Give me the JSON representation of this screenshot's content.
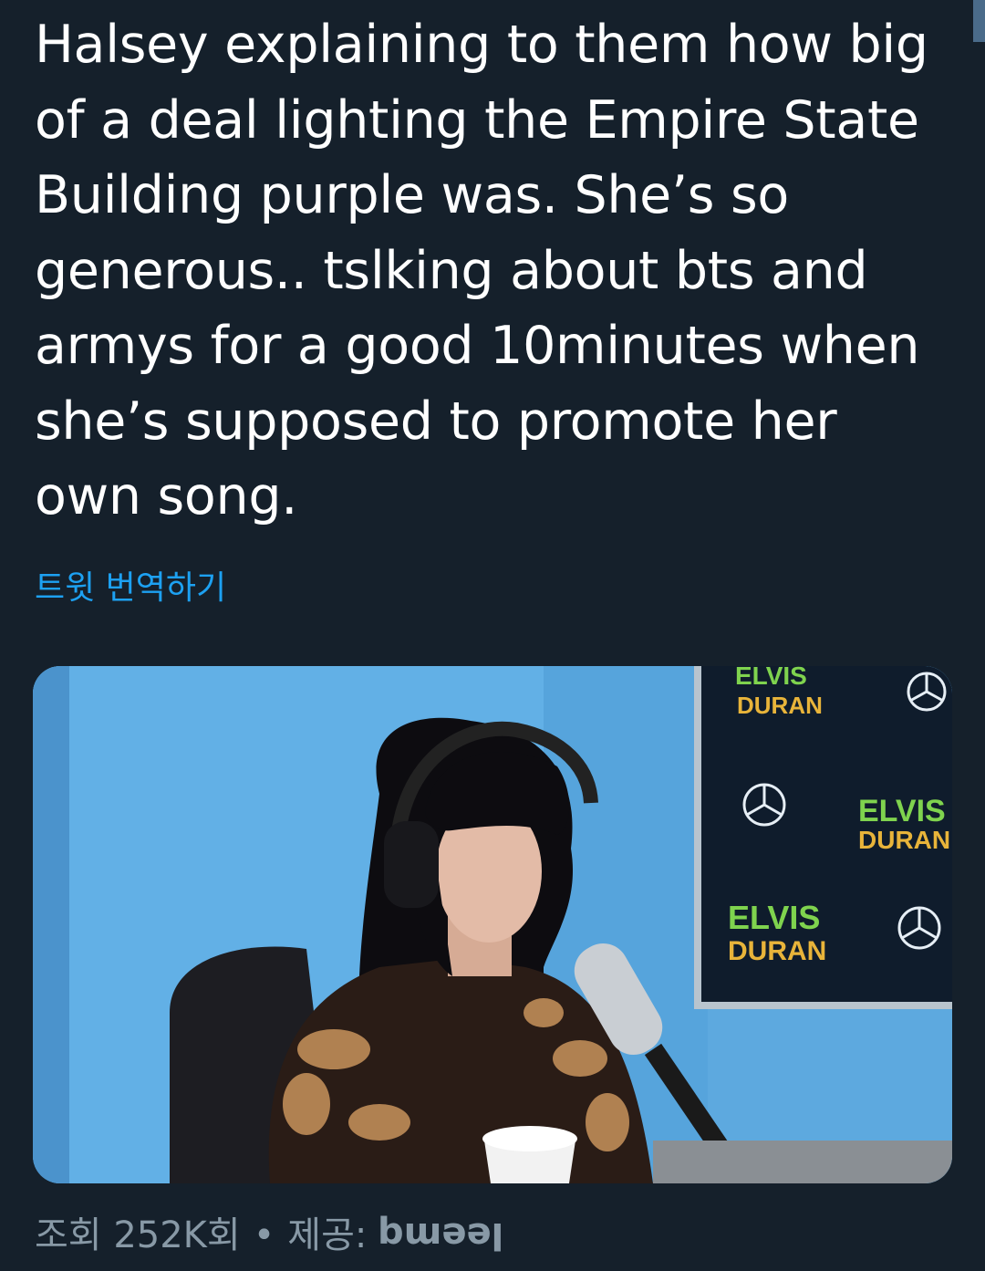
{
  "tweet": {
    "text": "Halsey explaining to them how big of a deal lighting the Empire State Building purple was. She’s so generous.. tslking about bts and armys for a good 10minutes when she’s supposed to promote her own song.",
    "translate_label": "트윗 번역하기"
  },
  "media": {
    "backdrop_logo_text_1": "ELVIS",
    "backdrop_logo_text_2": "DURAN"
  },
  "footer": {
    "views_label": "조회 252K회",
    "separator": "•",
    "source_label": "제공:",
    "source_handle": "leemq"
  },
  "colors": {
    "background": "#15202b",
    "link": "#1da1f2",
    "muted": "#8899a6"
  }
}
